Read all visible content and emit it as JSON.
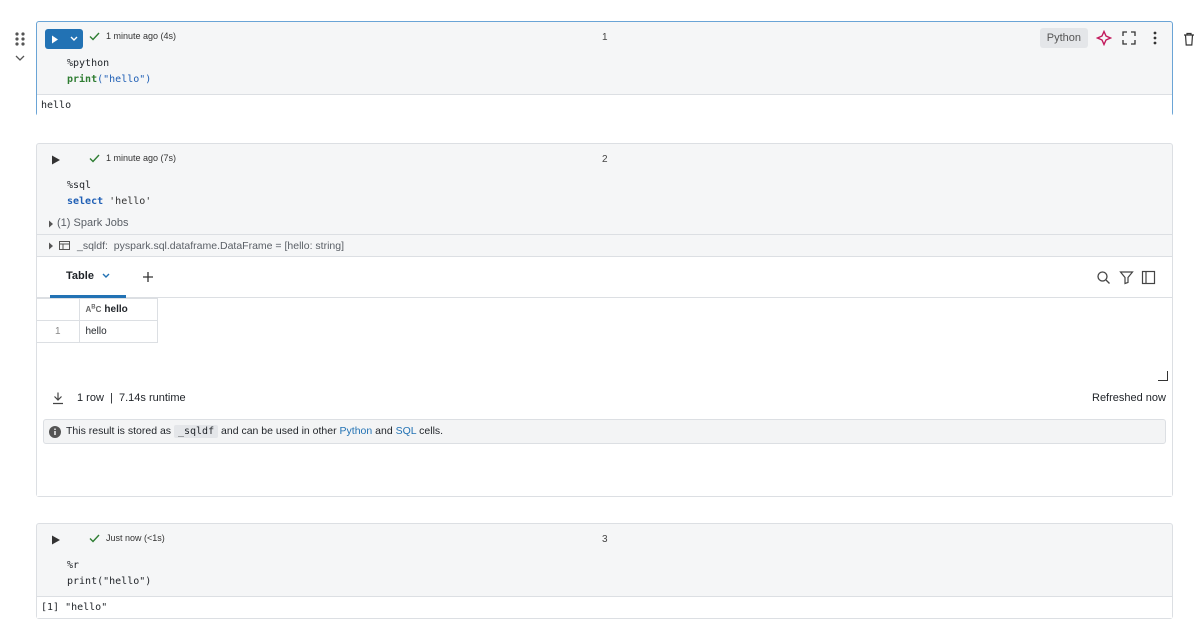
{
  "cells": [
    {
      "status": "1 minute ago (4s)",
      "number": "1",
      "language": "Python",
      "code": [
        {
          "magic": "%python"
        },
        {
          "fn": "print",
          "arg": "(\"hello\")"
        }
      ],
      "output": "hello"
    },
    {
      "status": "1 minute ago (7s)",
      "number": "2",
      "code": [
        {
          "magic": "%sql"
        },
        {
          "kw": "select",
          "arg": "'hello'"
        }
      ],
      "spark_jobs": "(1) Spark Jobs",
      "dataframe_name": "_sqldf:",
      "dataframe_type": "pyspark.sql.dataframe.DataFrame = [hello: string]",
      "result": {
        "tab_label": "Table",
        "column_type": "ABC",
        "columns": [
          "hello"
        ],
        "rows": [
          {
            "index": "1",
            "values": [
              "hello"
            ]
          }
        ],
        "row_info": "1 row  |  7.14s runtime",
        "refreshed": "Refreshed now",
        "info_prefix": "This result is stored as",
        "info_var": "_sqldf",
        "info_middle": "and can be used in other",
        "info_python": "Python",
        "info_and": "and",
        "info_sql": "SQL",
        "info_suffix": "cells."
      }
    },
    {
      "status": "Just now (<1s)",
      "number": "3",
      "code": [
        {
          "magic": "%r"
        },
        {
          "plain": "print(\"hello\")"
        }
      ],
      "output": "[1] \"hello\""
    }
  ],
  "colors": {
    "accent": "#2272b4",
    "success": "#2e7d32",
    "assistant": "#c2185b"
  }
}
